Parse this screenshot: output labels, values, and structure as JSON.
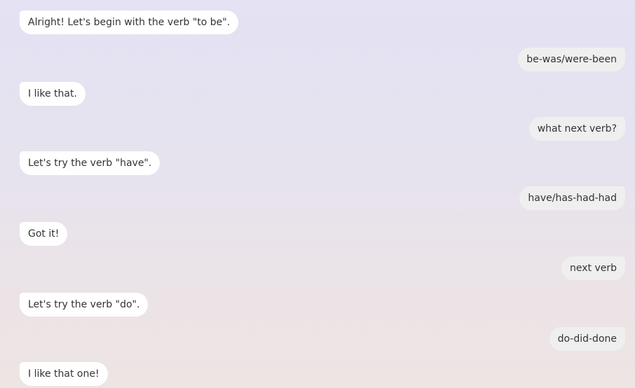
{
  "messages": [
    {
      "role": "ai",
      "text": "Alright! Let's begin with the verb \"to be\"."
    },
    {
      "role": "user",
      "text": "be-was/were-been"
    },
    {
      "role": "ai",
      "text": "I like that."
    },
    {
      "role": "user",
      "text": "what next verb?"
    },
    {
      "role": "ai",
      "text": "Let's try the verb \"have\"."
    },
    {
      "role": "user",
      "text": "have/has-had-had"
    },
    {
      "role": "ai",
      "text": "Got it!"
    },
    {
      "role": "user",
      "text": "next verb"
    },
    {
      "role": "ai",
      "text": "Let's try the verb \"do\"."
    },
    {
      "role": "user",
      "text": "do-did-done"
    },
    {
      "role": "ai",
      "text": "I like that one!"
    }
  ]
}
